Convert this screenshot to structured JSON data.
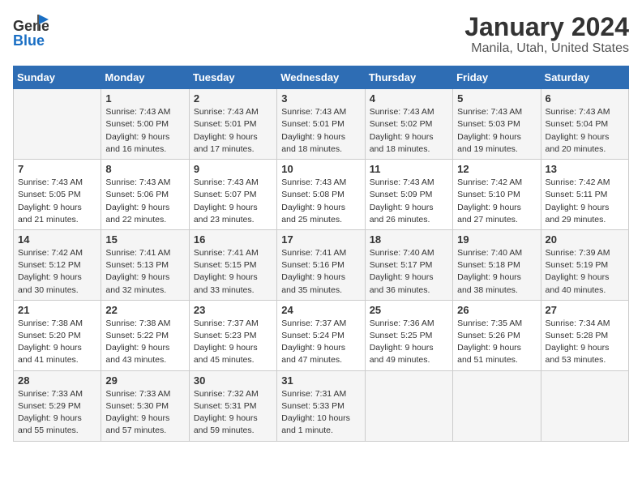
{
  "header": {
    "logo_general": "General",
    "logo_blue": "Blue",
    "title": "January 2024",
    "subtitle": "Manila, Utah, United States"
  },
  "calendar": {
    "days_of_week": [
      "Sunday",
      "Monday",
      "Tuesday",
      "Wednesday",
      "Thursday",
      "Friday",
      "Saturday"
    ],
    "weeks": [
      [
        {
          "num": "",
          "info": ""
        },
        {
          "num": "1",
          "info": "Sunrise: 7:43 AM\nSunset: 5:00 PM\nDaylight: 9 hours\nand 16 minutes."
        },
        {
          "num": "2",
          "info": "Sunrise: 7:43 AM\nSunset: 5:01 PM\nDaylight: 9 hours\nand 17 minutes."
        },
        {
          "num": "3",
          "info": "Sunrise: 7:43 AM\nSunset: 5:01 PM\nDaylight: 9 hours\nand 18 minutes."
        },
        {
          "num": "4",
          "info": "Sunrise: 7:43 AM\nSunset: 5:02 PM\nDaylight: 9 hours\nand 18 minutes."
        },
        {
          "num": "5",
          "info": "Sunrise: 7:43 AM\nSunset: 5:03 PM\nDaylight: 9 hours\nand 19 minutes."
        },
        {
          "num": "6",
          "info": "Sunrise: 7:43 AM\nSunset: 5:04 PM\nDaylight: 9 hours\nand 20 minutes."
        }
      ],
      [
        {
          "num": "7",
          "info": "Sunrise: 7:43 AM\nSunset: 5:05 PM\nDaylight: 9 hours\nand 21 minutes."
        },
        {
          "num": "8",
          "info": "Sunrise: 7:43 AM\nSunset: 5:06 PM\nDaylight: 9 hours\nand 22 minutes."
        },
        {
          "num": "9",
          "info": "Sunrise: 7:43 AM\nSunset: 5:07 PM\nDaylight: 9 hours\nand 23 minutes."
        },
        {
          "num": "10",
          "info": "Sunrise: 7:43 AM\nSunset: 5:08 PM\nDaylight: 9 hours\nand 25 minutes."
        },
        {
          "num": "11",
          "info": "Sunrise: 7:43 AM\nSunset: 5:09 PM\nDaylight: 9 hours\nand 26 minutes."
        },
        {
          "num": "12",
          "info": "Sunrise: 7:42 AM\nSunset: 5:10 PM\nDaylight: 9 hours\nand 27 minutes."
        },
        {
          "num": "13",
          "info": "Sunrise: 7:42 AM\nSunset: 5:11 PM\nDaylight: 9 hours\nand 29 minutes."
        }
      ],
      [
        {
          "num": "14",
          "info": "Sunrise: 7:42 AM\nSunset: 5:12 PM\nDaylight: 9 hours\nand 30 minutes."
        },
        {
          "num": "15",
          "info": "Sunrise: 7:41 AM\nSunset: 5:13 PM\nDaylight: 9 hours\nand 32 minutes."
        },
        {
          "num": "16",
          "info": "Sunrise: 7:41 AM\nSunset: 5:15 PM\nDaylight: 9 hours\nand 33 minutes."
        },
        {
          "num": "17",
          "info": "Sunrise: 7:41 AM\nSunset: 5:16 PM\nDaylight: 9 hours\nand 35 minutes."
        },
        {
          "num": "18",
          "info": "Sunrise: 7:40 AM\nSunset: 5:17 PM\nDaylight: 9 hours\nand 36 minutes."
        },
        {
          "num": "19",
          "info": "Sunrise: 7:40 AM\nSunset: 5:18 PM\nDaylight: 9 hours\nand 38 minutes."
        },
        {
          "num": "20",
          "info": "Sunrise: 7:39 AM\nSunset: 5:19 PM\nDaylight: 9 hours\nand 40 minutes."
        }
      ],
      [
        {
          "num": "21",
          "info": "Sunrise: 7:38 AM\nSunset: 5:20 PM\nDaylight: 9 hours\nand 41 minutes."
        },
        {
          "num": "22",
          "info": "Sunrise: 7:38 AM\nSunset: 5:22 PM\nDaylight: 9 hours\nand 43 minutes."
        },
        {
          "num": "23",
          "info": "Sunrise: 7:37 AM\nSunset: 5:23 PM\nDaylight: 9 hours\nand 45 minutes."
        },
        {
          "num": "24",
          "info": "Sunrise: 7:37 AM\nSunset: 5:24 PM\nDaylight: 9 hours\nand 47 minutes."
        },
        {
          "num": "25",
          "info": "Sunrise: 7:36 AM\nSunset: 5:25 PM\nDaylight: 9 hours\nand 49 minutes."
        },
        {
          "num": "26",
          "info": "Sunrise: 7:35 AM\nSunset: 5:26 PM\nDaylight: 9 hours\nand 51 minutes."
        },
        {
          "num": "27",
          "info": "Sunrise: 7:34 AM\nSunset: 5:28 PM\nDaylight: 9 hours\nand 53 minutes."
        }
      ],
      [
        {
          "num": "28",
          "info": "Sunrise: 7:33 AM\nSunset: 5:29 PM\nDaylight: 9 hours\nand 55 minutes."
        },
        {
          "num": "29",
          "info": "Sunrise: 7:33 AM\nSunset: 5:30 PM\nDaylight: 9 hours\nand 57 minutes."
        },
        {
          "num": "30",
          "info": "Sunrise: 7:32 AM\nSunset: 5:31 PM\nDaylight: 9 hours\nand 59 minutes."
        },
        {
          "num": "31",
          "info": "Sunrise: 7:31 AM\nSunset: 5:33 PM\nDaylight: 10 hours\nand 1 minute."
        },
        {
          "num": "",
          "info": ""
        },
        {
          "num": "",
          "info": ""
        },
        {
          "num": "",
          "info": ""
        }
      ]
    ]
  }
}
